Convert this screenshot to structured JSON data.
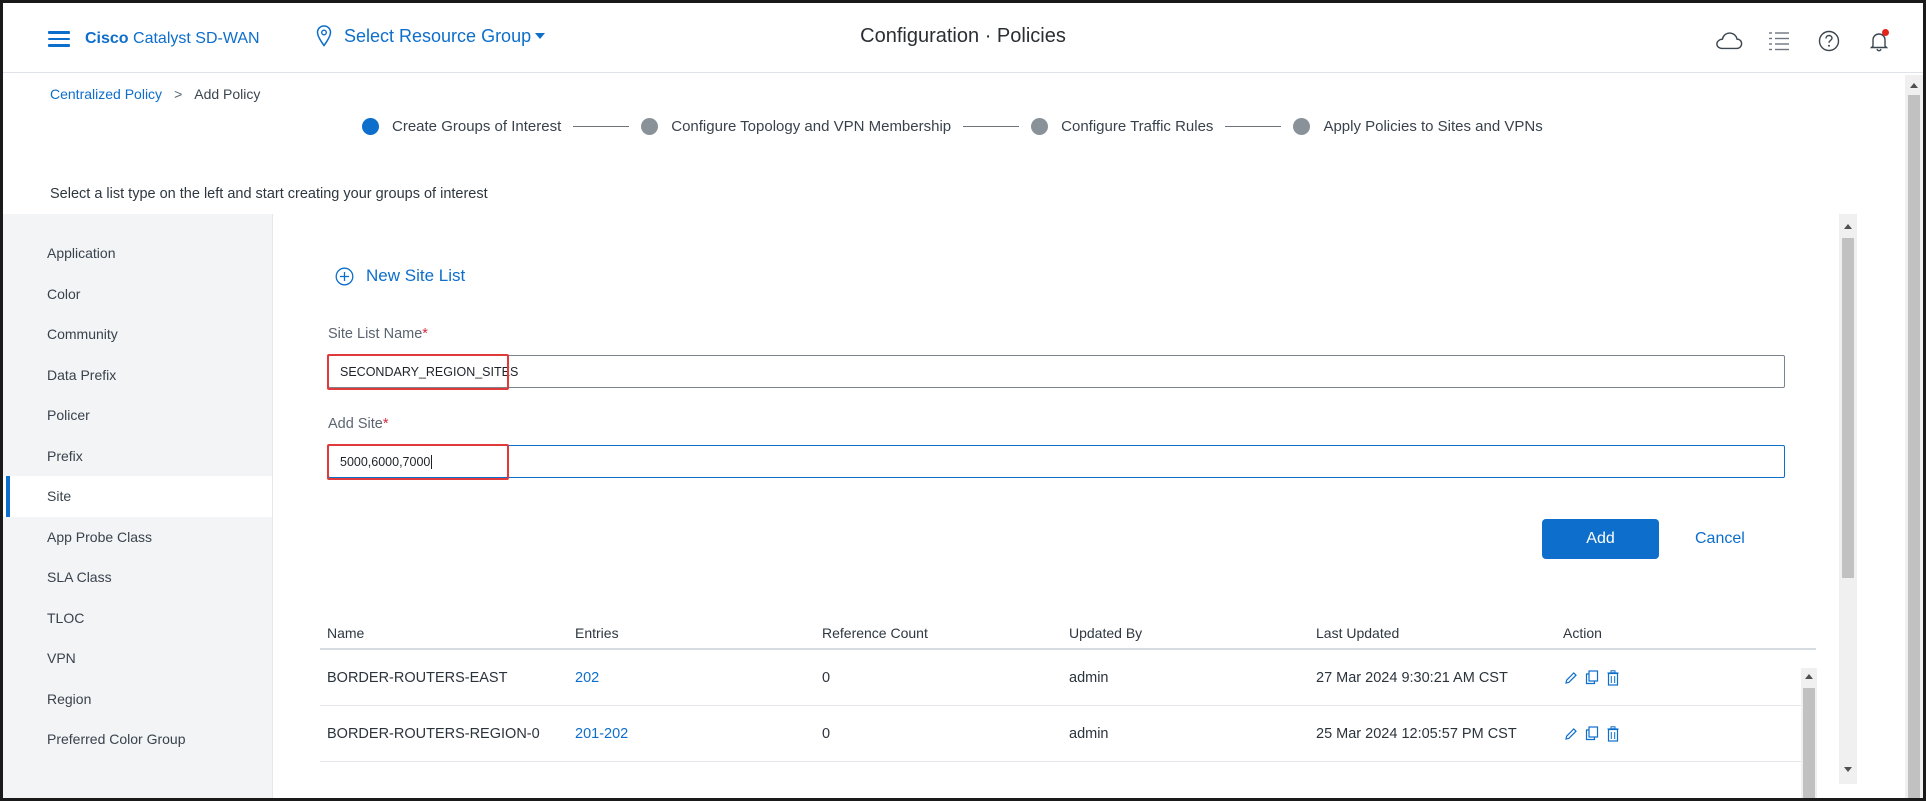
{
  "header": {
    "brand_bold": "Cisco",
    "brand_rest": "Catalyst SD-WAN",
    "resource_group": "Select Resource Group",
    "title_left": "Configuration",
    "title_sep": "·",
    "title_right": "Policies",
    "icons": [
      "cloud-icon",
      "task-list-icon",
      "help-icon",
      "bell-icon"
    ]
  },
  "breadcrumb": {
    "parent": "Centralized Policy",
    "separator": ">",
    "current": "Add Policy"
  },
  "stepper": [
    {
      "label": "Create Groups of Interest",
      "state": "active"
    },
    {
      "label": "Configure Topology and VPN Membership",
      "state": "inactive"
    },
    {
      "label": "Configure Traffic Rules",
      "state": "inactive"
    },
    {
      "label": "Apply Policies to Sites and VPNs",
      "state": "inactive"
    }
  ],
  "instruction": "Select a list type on the left and start creating your groups of interest",
  "sidebar": {
    "items": [
      {
        "label": "Application"
      },
      {
        "label": "Color"
      },
      {
        "label": "Community"
      },
      {
        "label": "Data Prefix"
      },
      {
        "label": "Policer"
      },
      {
        "label": "Prefix"
      },
      {
        "label": "Site"
      },
      {
        "label": "App Probe Class"
      },
      {
        "label": "SLA Class"
      },
      {
        "label": "TLOC"
      },
      {
        "label": "VPN"
      },
      {
        "label": "Region"
      },
      {
        "label": "Preferred Color Group"
      }
    ],
    "active": "Site"
  },
  "form": {
    "new_list_label": "New Site List",
    "site_list_name_label": "Site List Name",
    "site_list_name_value": "SECONDARY_REGION_SITES",
    "add_site_label": "Add Site",
    "add_site_value": "5000,6000,7000",
    "required_mark": "*",
    "add_button": "Add",
    "cancel_button": "Cancel"
  },
  "table": {
    "columns": [
      "Name",
      "Entries",
      "Reference Count",
      "Updated By",
      "Last Updated",
      "Action"
    ],
    "rows": [
      {
        "name": "BORDER-ROUTERS-EAST",
        "entries": "202",
        "reference_count": "0",
        "updated_by": "admin",
        "last_updated": "27 Mar 2024 9:30:21 AM CST"
      },
      {
        "name": "BORDER-ROUTERS-REGION-0",
        "entries": "201-202",
        "reference_count": "0",
        "updated_by": "admin",
        "last_updated": "25 Mar 2024 12:05:57 PM CST"
      }
    ]
  },
  "colors": {
    "accent": "#0d6ecb",
    "highlight": "#e03a3a",
    "required": "#d6293e"
  }
}
